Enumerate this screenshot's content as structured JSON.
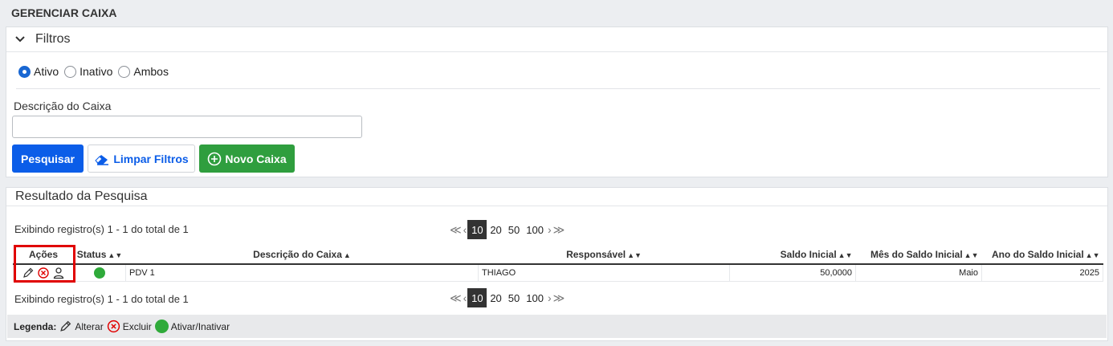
{
  "page": {
    "title": "GERENCIAR CAIXA"
  },
  "filters": {
    "title": "Filtros",
    "radios": [
      {
        "label": "Ativo",
        "checked": true
      },
      {
        "label": "Inativo",
        "checked": false
      },
      {
        "label": "Ambos",
        "checked": false
      }
    ],
    "description_label": "Descrição do Caixa",
    "description_value": "",
    "search_label": "Pesquisar",
    "clear_label": "Limpar Filtros",
    "new_label": "Novo Caixa"
  },
  "results": {
    "title": "Resultado da Pesquisa",
    "info_top": "Exibindo registro(s) 1 - 1 do total de 1",
    "info_bottom": "Exibindo registro(s) 1 - 1 do total de 1",
    "pager": {
      "current": "10",
      "sizes": [
        "20",
        "50",
        "100"
      ]
    },
    "columns": [
      "Ações",
      "Status",
      "Descrição do Caixa",
      "Responsável",
      "Saldo Inicial",
      "Mês do Saldo Inicial",
      "Ano do Saldo Inicial"
    ],
    "rows": [
      {
        "status": "active",
        "descricao": "PDV 1",
        "responsavel": "THIAGO",
        "saldo": "50,0000",
        "mes": "Maio",
        "ano": "2025"
      }
    ],
    "legend": {
      "title": "Legenda:",
      "edit": "Alterar",
      "delete": "Excluir",
      "toggle": "Ativar/Inativar"
    }
  },
  "colors": {
    "primary": "#0b5de8",
    "success": "#2f9e3e",
    "danger": "#e00000",
    "status_active": "#2faa3a"
  }
}
